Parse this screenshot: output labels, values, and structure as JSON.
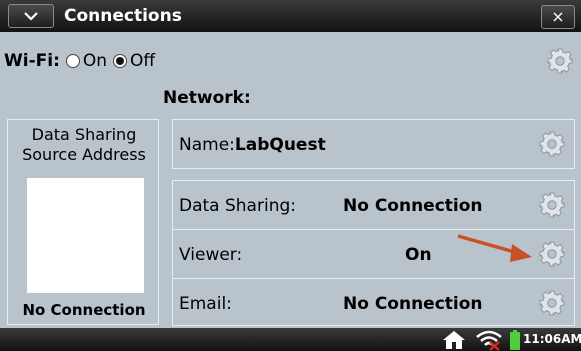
{
  "window": {
    "title": "Connections",
    "menu_icon": "chevron-down-icon",
    "close_label": "×"
  },
  "wifi": {
    "label": "Wi-Fi:",
    "on_label": "On",
    "off_label": "Off",
    "selected": "Off",
    "gear_icon": "gear-icon"
  },
  "network": {
    "heading": "Network:"
  },
  "source": {
    "title": "Data Sharing Source Address",
    "status": "No Connection"
  },
  "name_row": {
    "label": "Name:",
    "value": "LabQuest"
  },
  "rows": [
    {
      "label": "Data Sharing:",
      "value": "No Connection"
    },
    {
      "label": "Viewer:",
      "value": "On"
    },
    {
      "label": "Email:",
      "value": "No Connection"
    }
  ],
  "statusbar": {
    "icons": [
      "home-icon",
      "wifi-off-icon",
      "battery-icon"
    ],
    "time": "11:06AM"
  },
  "colors": {
    "background": "#b9c3cc",
    "bar": "#1e1e1e",
    "arrow": "#c8502a",
    "battery": "#4ccf3a",
    "wifi_off_x": "#d02a1e"
  }
}
